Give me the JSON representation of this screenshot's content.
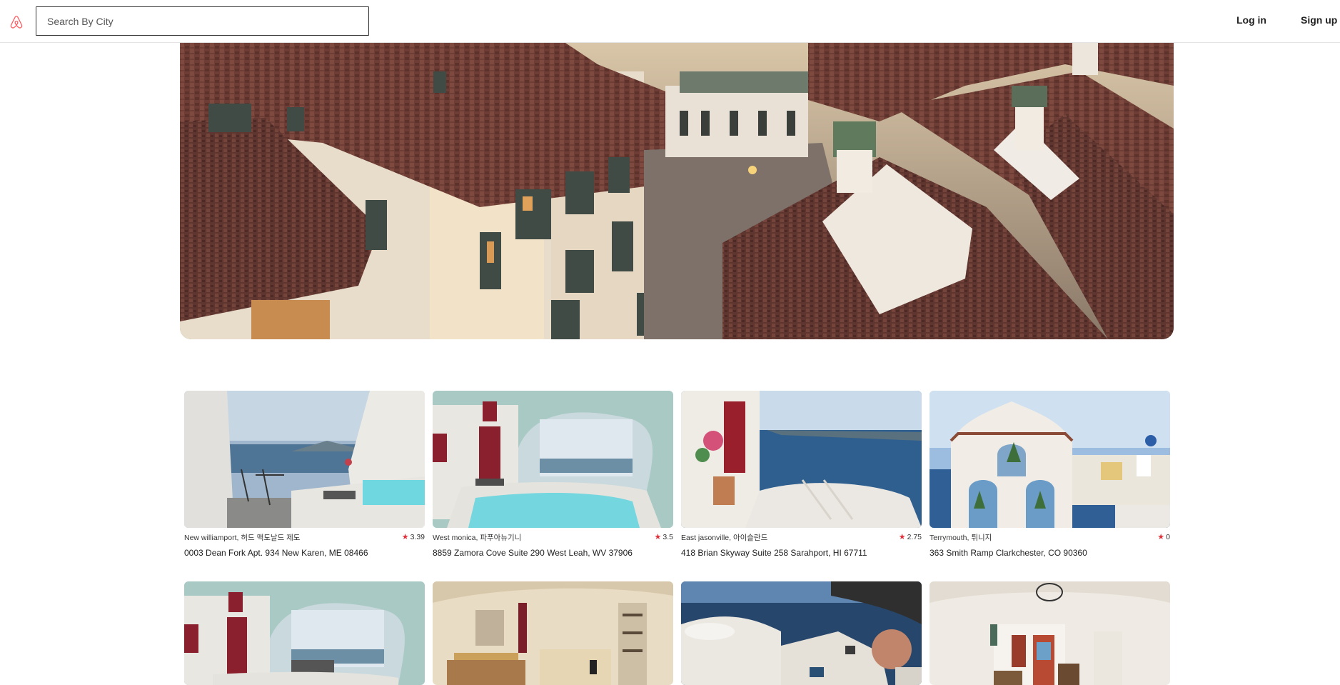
{
  "header": {
    "logo_icon": "airbnb-logo-icon",
    "search_placeholder": "Search By City",
    "search_value": "",
    "login_label": "Log in",
    "signup_label": "Sign up"
  },
  "colors": {
    "accent": "#ff5a5f",
    "star": "#e0323c"
  },
  "listings": [
    {
      "city": "New williamport, 허드 맥도날드 제도",
      "rating": "3.39",
      "address": "0003 Dean Fork Apt. 934 New Karen, ME 08466"
    },
    {
      "city": "West monica, 파푸아뉴기니",
      "rating": "3.5",
      "address": "8859 Zamora Cove Suite 290 West Leah, WV 37906"
    },
    {
      "city": "East jasonville, 아이슬란드",
      "rating": "2.75",
      "address": "418 Brian Skyway Suite 258 Sarahport, HI 67711"
    },
    {
      "city": "Terrymouth, 튀니지",
      "rating": "0",
      "address": "363 Smith Ramp Clarkchester, CO 90360"
    }
  ]
}
